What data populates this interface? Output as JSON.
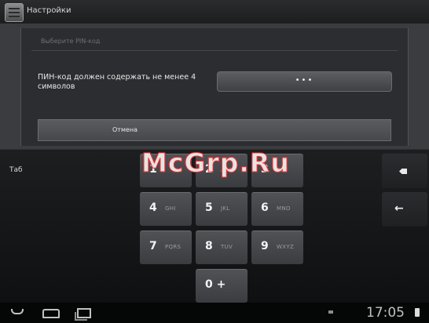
{
  "titlebar": {
    "title": "Настройки",
    "icon": "settings-app-icon"
  },
  "dialog": {
    "title": "Выберите PIN-код",
    "message": "ПИН-код должен содержать не менее 4 символов",
    "pin_value": "•••",
    "cancel_label": "Отмена"
  },
  "keyboard": {
    "tab_label": "Таб",
    "keys": [
      {
        "num": "1",
        "letters": ""
      },
      {
        "num": "2",
        "letters": "ABC"
      },
      {
        "num": "3",
        "letters": "DEF"
      },
      {
        "num": "4",
        "letters": "GHI"
      },
      {
        "num": "5",
        "letters": "JKL"
      },
      {
        "num": "6",
        "letters": "MNO"
      },
      {
        "num": "7",
        "letters": "PQRS"
      },
      {
        "num": "8",
        "letters": "TUV"
      },
      {
        "num": "9",
        "letters": "WXYZ"
      },
      {
        "num": "0 +",
        "letters": ""
      }
    ],
    "backspace_icon": "backspace-icon",
    "enter_icon": "enter-icon",
    "enter_glyph": "←"
  },
  "watermark": "McGrp.Ru",
  "navbar": {
    "time": "17:05",
    "icons": [
      "back-icon",
      "home-icon",
      "recent-apps-icon",
      "battery-icon"
    ]
  }
}
